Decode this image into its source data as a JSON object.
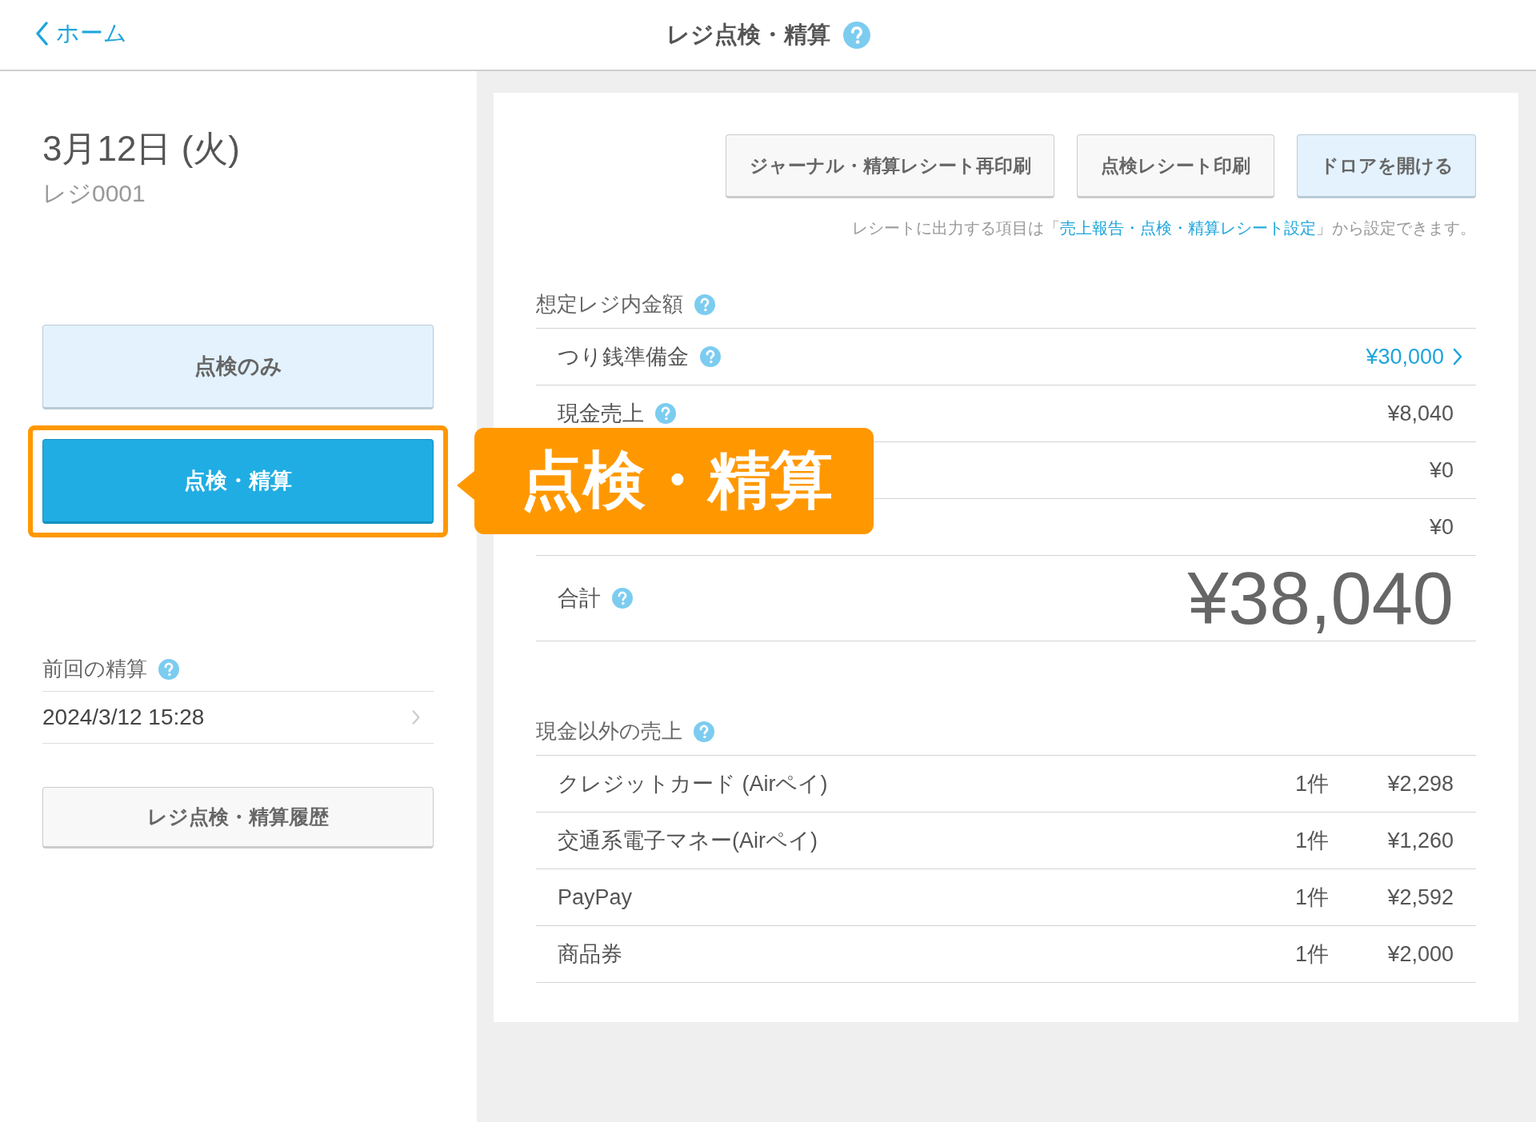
{
  "header": {
    "back_label": "ホーム",
    "title": "レジ点検・精算",
    "help": true
  },
  "left": {
    "date": "3月12日 (火)",
    "register": "レジ0001",
    "modes": [
      {
        "label": "点検のみ",
        "selected": false,
        "highlighted": false
      },
      {
        "label": "点検・精算",
        "selected": true,
        "highlighted": true
      }
    ],
    "callout": "点検・精算",
    "last_settlement": {
      "label": "前回の精算",
      "help": true,
      "value": "2024/3/12 15:28"
    },
    "history_button": "レジ点検・精算履歴"
  },
  "right": {
    "actions": [
      {
        "label": "ジャーナル・精算レシート再印刷",
        "kind": "default"
      },
      {
        "label": "点検レシート印刷",
        "kind": "default"
      },
      {
        "label": "ドロアを開ける",
        "kind": "primary"
      }
    ],
    "note": {
      "before": "レシートに出力する項目は「",
      "link": "売上報告・点検・精算レシート設定",
      "after": "」から設定できます。"
    },
    "sections": [
      {
        "title": "想定レジ内金額",
        "help": true,
        "rows": [
          {
            "kind": "amount",
            "label": "つり銭準備金",
            "help": true,
            "value": "¥30,000",
            "link": true
          },
          {
            "kind": "amount",
            "label": "現金売上",
            "help": true,
            "value": "¥8,040",
            "link": false
          },
          {
            "kind": "amount",
            "value": "¥0",
            "link": false
          },
          {
            "kind": "amount",
            "value": "¥0",
            "link": false
          },
          {
            "kind": "total",
            "label": "合計",
            "help": true,
            "value": "¥38,040"
          }
        ]
      },
      {
        "title": "現金以外の売上",
        "help": true,
        "rows": [
          {
            "kind": "count",
            "label": "クレジットカード (Airペイ)",
            "count": "1件",
            "value": "¥2,298"
          },
          {
            "kind": "count",
            "label": "交通系電子マネー(Airペイ)",
            "count": "1件",
            "value": "¥1,260"
          },
          {
            "kind": "count",
            "label": "PayPay",
            "count": "1件",
            "value": "¥2,592"
          },
          {
            "kind": "count",
            "label": "商品券",
            "count": "1件",
            "value": "¥2,000"
          }
        ]
      }
    ]
  }
}
